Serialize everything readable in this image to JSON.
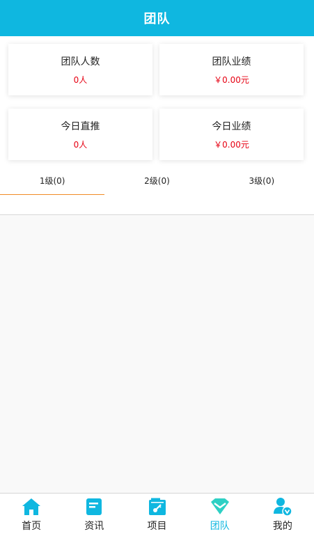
{
  "header": {
    "title": "团队"
  },
  "stats": [
    {
      "label": "团队人数",
      "value": "0人"
    },
    {
      "label": "团队业绩",
      "value": "￥0.00元"
    },
    {
      "label": "今日直推",
      "value": "0人"
    },
    {
      "label": "今日业绩",
      "value": "￥0.00元"
    }
  ],
  "tabs": [
    {
      "label": "1级(0)"
    },
    {
      "label": "2级(0)"
    },
    {
      "label": "3级(0)"
    }
  ],
  "active_tab": 0,
  "nav": [
    {
      "label": "首页",
      "icon": "home-icon"
    },
    {
      "label": "资讯",
      "icon": "news-icon"
    },
    {
      "label": "项目",
      "icon": "project-icon"
    },
    {
      "label": "团队",
      "icon": "team-icon"
    },
    {
      "label": "我的",
      "icon": "profile-icon"
    }
  ],
  "active_nav": 3,
  "colors": {
    "brand": "#0fb7e0",
    "value_red": "#e60012",
    "tab_underline": "#f08a24",
    "active_nav_icon": "#2ed0c4"
  }
}
